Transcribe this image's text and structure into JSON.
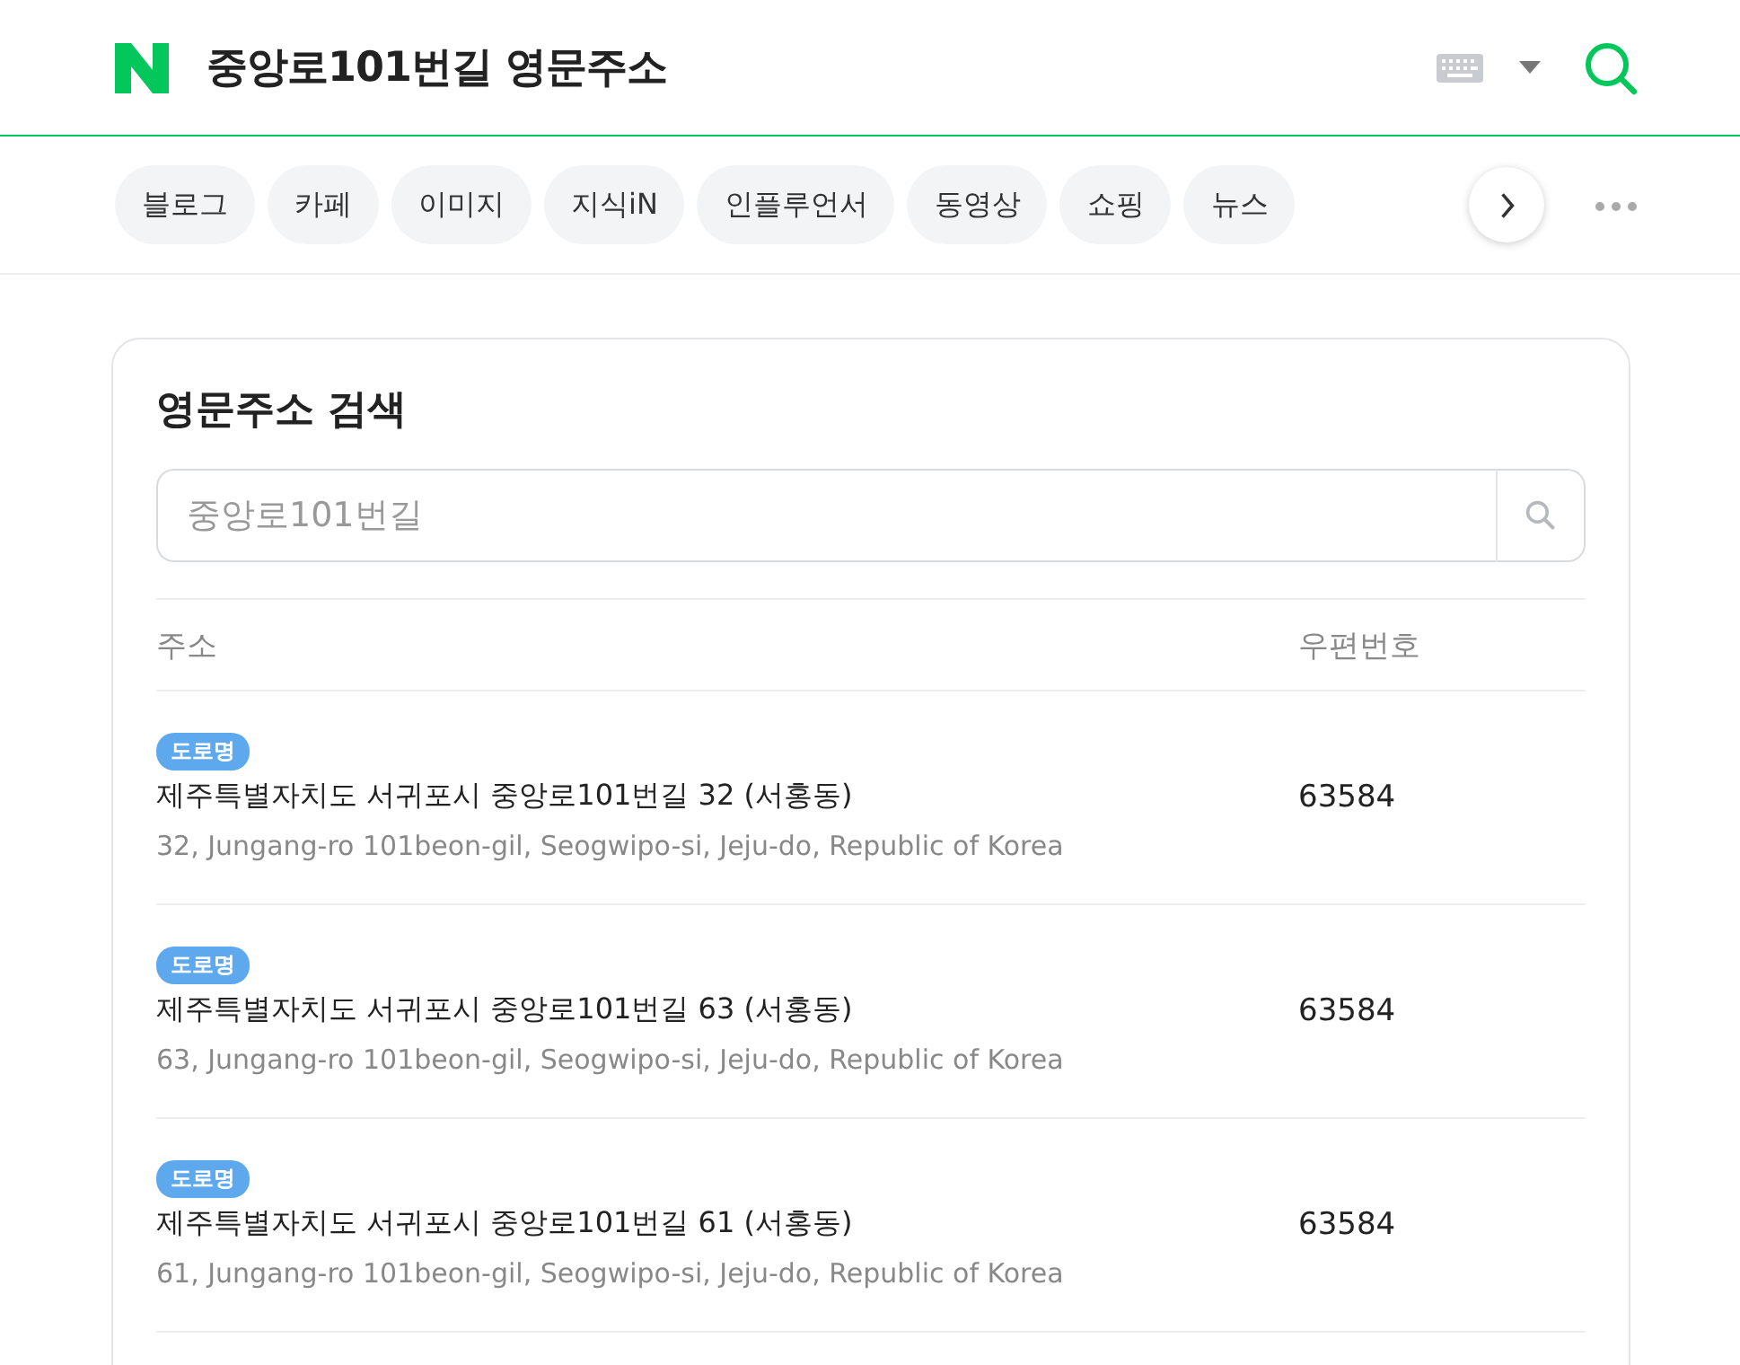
{
  "header": {
    "title": "중앙로101번길 영문주소"
  },
  "tabs": [
    {
      "label": "블로그",
      "selected": false
    },
    {
      "label": "카페",
      "selected": false
    },
    {
      "label": "이미지",
      "selected": false
    },
    {
      "label": "지식iN",
      "selected": false
    },
    {
      "label": "인플루언서",
      "selected": false
    },
    {
      "label": "동영상",
      "selected": false
    },
    {
      "label": "쇼핑",
      "selected": false
    },
    {
      "label": "뉴스",
      "selected": false
    }
  ],
  "card": {
    "title": "영문주소 검색",
    "search": {
      "placeholder": "중앙로101번길"
    },
    "columns": [
      "주소",
      "우편번호"
    ],
    "rows": [
      {
        "badge": "도로명",
        "address": "제주특별자치도 서귀포시 중앙로101번길 32 (서홍동)",
        "english": "32, Jungang-ro 101beon-gil, Seogwipo-si, Jeju-do, Republic of Korea",
        "postcode": "63584"
      },
      {
        "badge": "도로명",
        "address": "제주특별자치도 서귀포시 중앙로101번길 63 (서홍동)",
        "english": "63, Jungang-ro 101beon-gil, Seogwipo-si, Jeju-do, Republic of Korea",
        "postcode": "63584"
      },
      {
        "badge": "도로명",
        "address": "제주특별자치도 서귀포시 중앙로101번길 61 (서홍동)",
        "english": "61, Jungang-ro 101beon-gil, Seogwipo-si, Jeju-do, Republic of Korea",
        "postcode": "63584"
      }
    ]
  }
}
